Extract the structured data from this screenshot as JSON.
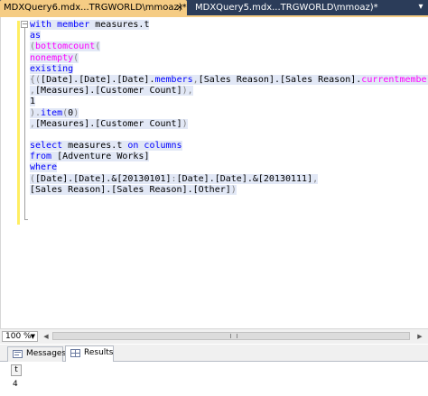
{
  "tabs": [
    {
      "label": "MDXQuery6.mdx...TRGWORLD\\mmoaz)*",
      "close": "×"
    },
    {
      "label": "MDXQuery5.mdx...TRGWORLD\\mmoaz)*"
    }
  ],
  "pin_glyph": "▾",
  "editor": {
    "lines": [
      [
        {
          "t": "with member measures.t"
        }
      ],
      [
        {
          "t": "as"
        }
      ],
      [
        {
          "t": "(bottomcount("
        }
      ],
      [
        {
          "t": "nonempty("
        }
      ],
      [
        {
          "t": "existing"
        }
      ],
      [
        {
          "t": "{([Date].[Date].[Date].members,[Sales Reason].[Sales Reason].currentmember)}"
        }
      ],
      [
        {
          "t": ",[Measures].[Customer Count]),"
        }
      ],
      [
        {
          "t": "1"
        }
      ],
      [
        {
          "t": ").item(0)"
        }
      ],
      [
        {
          "t": ",[Measures].[Customer Count])"
        }
      ],
      [
        {
          "t": ""
        }
      ],
      [
        {
          "t": "select measures.t on columns"
        }
      ],
      [
        {
          "t": "from [Adventure Works]"
        }
      ],
      [
        {
          "t": "where"
        }
      ],
      [
        {
          "t": "([Date].[Date].&[20130101]:[Date].[Date].&[20130111],"
        }
      ],
      [
        {
          "t": "[Sales Reason].[Sales Reason].[Other])"
        }
      ]
    ],
    "segments": [
      [
        {
          "text": "with member measures.t",
          "cls": "kw-first",
          "parts": [
            {
              "s": "with member",
              "c": "kw"
            },
            {
              "s": " measures.t",
              "c": ""
            }
          ]
        }
      ],
      [
        {
          "parts": [
            {
              "s": "as",
              "c": "kw"
            }
          ]
        }
      ],
      [
        {
          "parts": [
            {
              "s": "(",
              "c": "gray"
            },
            {
              "s": "bottomcount",
              "c": "fn"
            },
            {
              "s": "(",
              "c": "gray"
            }
          ]
        }
      ],
      [
        {
          "parts": [
            {
              "s": "nonempty",
              "c": "fn"
            },
            {
              "s": "(",
              "c": "gray"
            }
          ]
        }
      ],
      [
        {
          "parts": [
            {
              "s": "existing",
              "c": "kw"
            }
          ]
        }
      ],
      [
        {
          "parts": [
            {
              "s": "{(",
              "c": "gray"
            },
            {
              "s": "[Date].[Date].[Date].",
              "c": ""
            },
            {
              "s": "members",
              "c": "kw"
            },
            {
              "s": ",",
              "c": "gray"
            },
            {
              "s": "[Sales Reason].[Sales Reason].",
              "c": ""
            },
            {
              "s": "currentmember",
              "c": "fn"
            },
            {
              "s": ")}",
              "c": "gray"
            }
          ]
        }
      ],
      [
        {
          "parts": [
            {
              "s": ",",
              "c": "gray"
            },
            {
              "s": "[Measures].[Customer Count]",
              "c": ""
            },
            {
              "s": "),",
              "c": "gray"
            }
          ]
        }
      ],
      [
        {
          "parts": [
            {
              "s": "1",
              "c": ""
            }
          ]
        }
      ],
      [
        {
          "parts": [
            {
              "s": ").",
              "c": "gray"
            },
            {
              "s": "item",
              "c": "kw"
            },
            {
              "s": "(",
              "c": "gray"
            },
            {
              "s": "0",
              "c": ""
            },
            {
              "s": ")",
              "c": "gray"
            }
          ]
        }
      ],
      [
        {
          "parts": [
            {
              "s": ",",
              "c": "gray"
            },
            {
              "s": "[Measures].[Customer Count]",
              "c": ""
            },
            {
              "s": ")",
              "c": "gray"
            }
          ]
        }
      ],
      [
        {
          "parts": []
        }
      ],
      [
        {
          "parts": [
            {
              "s": "select",
              "c": "kw"
            },
            {
              "s": " measures.t ",
              "c": ""
            },
            {
              "s": "on columns",
              "c": "kw"
            }
          ]
        }
      ],
      [
        {
          "parts": [
            {
              "s": "from",
              "c": "kw"
            },
            {
              "s": " [Adventure Works]",
              "c": ""
            }
          ]
        }
      ],
      [
        {
          "parts": [
            {
              "s": "where",
              "c": "kw"
            }
          ]
        }
      ],
      [
        {
          "parts": [
            {
              "s": "(",
              "c": "gray"
            },
            {
              "s": "[Date].[Date].&[20130101]",
              "c": ""
            },
            {
              "s": ":",
              "c": "gray"
            },
            {
              "s": "[Date].[Date].&[20130111]",
              "c": ""
            },
            {
              "s": ",",
              "c": "gray"
            }
          ]
        }
      ],
      [
        {
          "parts": [
            {
              "s": "[Sales Reason].[Sales Reason].[Other]",
              "c": ""
            },
            {
              "s": ")",
              "c": "gray"
            }
          ]
        }
      ]
    ]
  },
  "statusbar": {
    "zoom": "100 %",
    "zoom_arrow": "▼",
    "scroll_left": "◀",
    "scroll_right": "▶"
  },
  "results_tabs": {
    "messages": "Messages",
    "results": "Results"
  },
  "results_grid": {
    "column_header": "t",
    "rows": [
      "4"
    ]
  }
}
